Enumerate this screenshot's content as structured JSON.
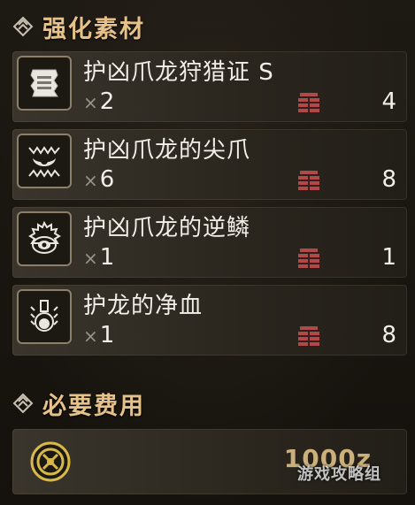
{
  "materials_section": {
    "title": "强化素材",
    "items": [
      {
        "name": "护凶爪龙狩猎证 S",
        "qty": "2",
        "owned": "4",
        "icon": "ticket-icon"
      },
      {
        "name": "护凶爪龙的尖爪",
        "qty": "6",
        "owned": "8",
        "icon": "claw-icon"
      },
      {
        "name": "护凶爪龙的逆鳞",
        "qty": "1",
        "owned": "1",
        "icon": "scale-icon"
      },
      {
        "name": "护龙的净血",
        "qty": "1",
        "owned": "8",
        "icon": "blood-flask-icon"
      }
    ],
    "times_symbol": "×"
  },
  "cost_section": {
    "title": "必要费用",
    "value": "1000z",
    "icon": "zenny-coin-icon"
  },
  "watermark": "游戏攻略组",
  "colors": {
    "header_gold": "#e6c28a",
    "text_white": "#f2efe8",
    "box_red": "#b04a4a"
  }
}
